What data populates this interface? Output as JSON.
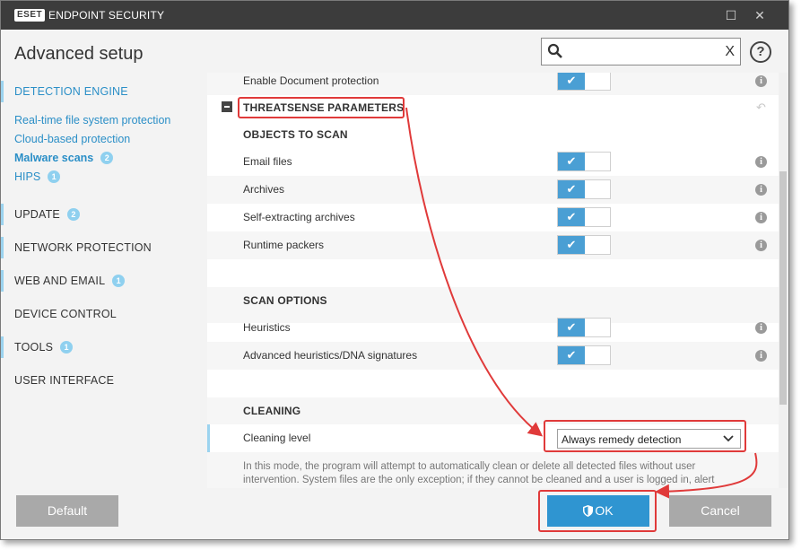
{
  "titlebar": {
    "logo": "ESET",
    "product": "ENDPOINT SECURITY",
    "minimize": "☐",
    "close": "✕"
  },
  "header": {
    "title": "Advanced setup",
    "search_placeholder": "",
    "search_clear": "X",
    "help": "?"
  },
  "sidebar": {
    "detection_engine": "DETECTION ENGINE",
    "subitems": [
      {
        "label": "Real-time file system protection"
      },
      {
        "label": "Cloud-based protection"
      },
      {
        "label": "Malware scans",
        "badge": "2"
      },
      {
        "label": "HIPS",
        "badge": "1"
      }
    ],
    "sections": [
      {
        "label": "UPDATE",
        "badge": "2"
      },
      {
        "label": "NETWORK PROTECTION"
      },
      {
        "label": "WEB AND EMAIL",
        "badge": "1"
      },
      {
        "label": "DEVICE CONTROL"
      },
      {
        "label": "TOOLS",
        "badge": "1"
      },
      {
        "label": "USER INTERFACE"
      }
    ]
  },
  "content": {
    "enable_document_protection": "Enable Document protection",
    "threatsense_title": "THREATSENSE PARAMETERS",
    "objects_header": "OBJECTS TO SCAN",
    "objects": [
      {
        "label": "Email files",
        "enabled": true
      },
      {
        "label": "Archives",
        "enabled": true
      },
      {
        "label": "Self-extracting archives",
        "enabled": true
      },
      {
        "label": "Runtime packers",
        "enabled": true
      }
    ],
    "scan_options_header": "SCAN OPTIONS",
    "scan_options": [
      {
        "label": "Heuristics",
        "enabled": true
      },
      {
        "label": "Advanced heuristics/DNA signatures",
        "enabled": true
      }
    ],
    "cleaning_header": "CLEANING",
    "cleaning_level_label": "Cleaning level",
    "cleaning_level_value": "Always remedy detection",
    "description": "In this mode, the program will attempt to automatically clean or delete all detected files without user intervention. System files are the only exception; if they cannot be cleaned and a user is logged in, alert",
    "check": "✔",
    "info": "i"
  },
  "footer": {
    "default_label": "Default",
    "ok_label": "OK",
    "cancel_label": "Cancel"
  },
  "colors": {
    "accent": "#2f95d1",
    "highlight": "#e03a3a",
    "titlebar": "#3c3c3c"
  }
}
